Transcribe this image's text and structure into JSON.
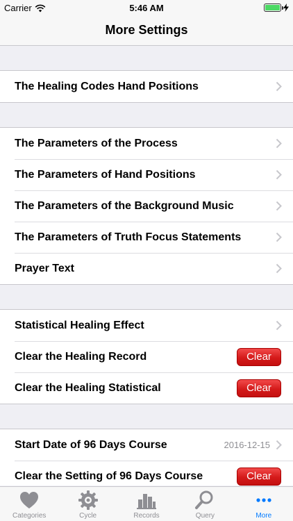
{
  "status_bar": {
    "carrier": "Carrier",
    "time": "5:46 AM"
  },
  "nav": {
    "title": "More Settings"
  },
  "sections": [
    {
      "rows": [
        {
          "label": "The Healing Codes Hand Positions"
        }
      ]
    },
    {
      "rows": [
        {
          "label": "The Parameters of the Process"
        },
        {
          "label": "The Parameters of Hand Positions"
        },
        {
          "label": "The Parameters of the Background Music"
        },
        {
          "label": "The Parameters of Truth Focus Statements"
        },
        {
          "label": "Prayer Text"
        }
      ]
    },
    {
      "rows": [
        {
          "label": "Statistical Healing Effect"
        },
        {
          "label": "Clear the Healing Record",
          "button": "Clear"
        },
        {
          "label": "Clear the Healing Statistical",
          "button": "Clear"
        }
      ]
    },
    {
      "rows": [
        {
          "label": "Start Date of 96 Days Course",
          "detail": "2016-12-15"
        },
        {
          "label": "Clear the Setting of 96 Days Course",
          "button": "Clear"
        }
      ]
    }
  ],
  "tabs": [
    {
      "label": "Categories",
      "icon": "heart-icon"
    },
    {
      "label": "Cycle",
      "icon": "gear-icon"
    },
    {
      "label": "Records",
      "icon": "bar-chart-icon"
    },
    {
      "label": "Query",
      "icon": "magnifier-icon"
    },
    {
      "label": "More",
      "icon": "more-dots-icon",
      "active": true
    }
  ],
  "colors": {
    "accent": "#007aff",
    "clear_button": "#d41a1a",
    "battery": "#4cd964",
    "tab_inactive": "#8e8e93"
  }
}
